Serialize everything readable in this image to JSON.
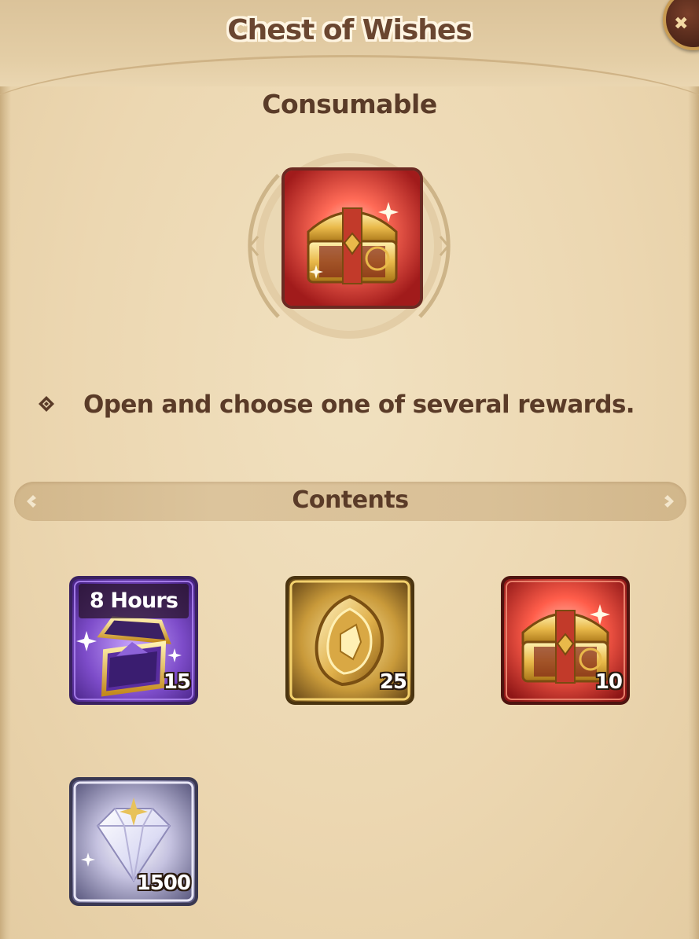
{
  "header": {
    "title": "Chest of Wishes",
    "close_icon": "close-icon"
  },
  "item": {
    "type": "Consumable",
    "icon": "treasure-chest-icon",
    "description": "Open and choose one of several rewards."
  },
  "contents": {
    "heading": "Contents",
    "rewards": [
      {
        "icon": "purple-chest-icon",
        "tag": "8 Hours",
        "count": "15"
      },
      {
        "icon": "gold-emblem-coin-icon",
        "tag": "",
        "count": "25"
      },
      {
        "icon": "treasure-chest-icon",
        "tag": "",
        "count": "10"
      },
      {
        "icon": "diamond-icon",
        "tag": "",
        "count": "1500"
      }
    ]
  },
  "colors": {
    "panel": "#ecd9b4",
    "text": "#5a3b28",
    "title_fill": "#6a4630",
    "title_outline": "#fff5e2",
    "rarity_purple": "#8a5cd4",
    "rarity_gold": "#d9a52a",
    "rarity_red": "#d8342b",
    "rarity_silver": "#b9b4c8"
  }
}
